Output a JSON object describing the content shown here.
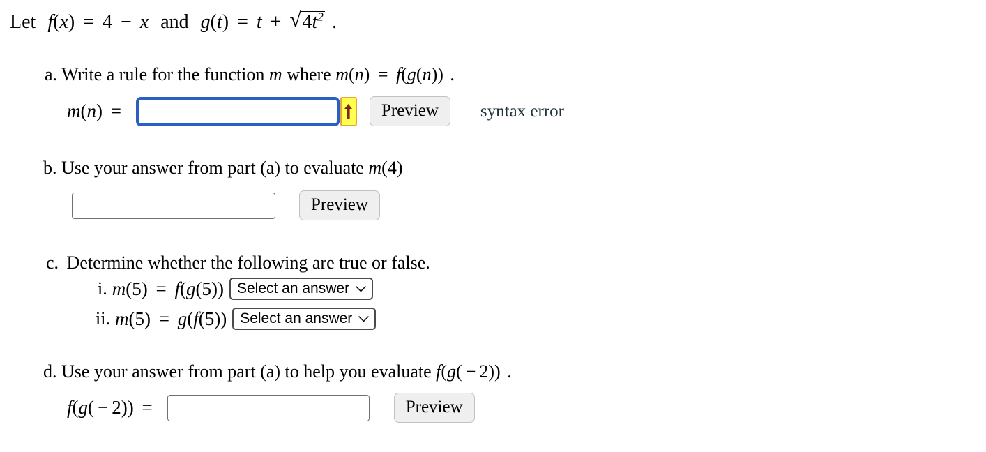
{
  "colors": {
    "focus_border": "#2a5fc4",
    "arrow_button_bg": "#ffff4d",
    "arrow_button_border": "#e8a33d",
    "arrow_glyph": "#7a2718",
    "error_text": "#1d3338",
    "button_bg": "#efefef",
    "input_border": "#707070",
    "select_border": "#4a4a4a",
    "page_bg": "#ffffff"
  },
  "stem": {
    "lead": "Let",
    "f_name": "f",
    "f_arg": "x",
    "f_equals": "=",
    "f_body_num": "4",
    "f_body_op": "−",
    "f_body_var": "x",
    "conjunction": "and",
    "g_name": "g",
    "g_arg": "t",
    "g_equals": "=",
    "g_body_var": "t",
    "g_body_op": "+",
    "radicand_coeff": "4",
    "radicand_var": "t",
    "radicand_exp": "2",
    "radical_glyph": "√",
    "period": "."
  },
  "parts": {
    "a": {
      "marker": "a.",
      "prompt_pre": "Write a rule for the function",
      "prompt_var": "m",
      "prompt_mid": "where",
      "prompt_lhs_name": "m",
      "prompt_lhs_arg": "n",
      "prompt_equals": "=",
      "prompt_rhs_outer": "f",
      "prompt_rhs_inner": "g",
      "prompt_rhs_arg": "n",
      "prompt_end": ".",
      "label_name": "m",
      "label_arg": "n",
      "label_equals": "=",
      "input_value": "",
      "input_placeholder": "",
      "arrow_icon": "up-arrow-icon",
      "preview_label": "Preview",
      "status": "syntax error"
    },
    "b": {
      "marker": "b.",
      "prompt_pre": "Use your answer from part (a) to evaluate",
      "prompt_fn": "m",
      "prompt_arg": "4",
      "input_value": "",
      "input_placeholder": "",
      "preview_label": "Preview"
    },
    "c": {
      "marker": "c.",
      "prompt": "Determine whether the following are true or false.",
      "items": [
        {
          "numeral": "i.",
          "lhs_name": "m",
          "lhs_arg": "5",
          "equals": "=",
          "rhs_outer": "f",
          "rhs_inner": "g",
          "rhs_arg": "5",
          "select_value": "Select an answer",
          "select_icon": "chevron-down-icon"
        },
        {
          "numeral": "ii.",
          "lhs_name": "m",
          "lhs_arg": "5",
          "equals": "=",
          "rhs_outer": "g",
          "rhs_inner": "f",
          "rhs_arg": "5",
          "select_value": "Select an answer",
          "select_icon": "chevron-down-icon"
        }
      ]
    },
    "d": {
      "marker": "d.",
      "prompt_pre": "Use your answer from part (a) to help you evaluate",
      "prompt_outer": "f",
      "prompt_inner": "g",
      "prompt_op": "−",
      "prompt_num": "2",
      "prompt_end": ".",
      "label_outer": "f",
      "label_inner": "g",
      "label_op": "−",
      "label_num": "2",
      "label_equals": "=",
      "input_value": "",
      "input_placeholder": "",
      "preview_label": "Preview"
    }
  }
}
